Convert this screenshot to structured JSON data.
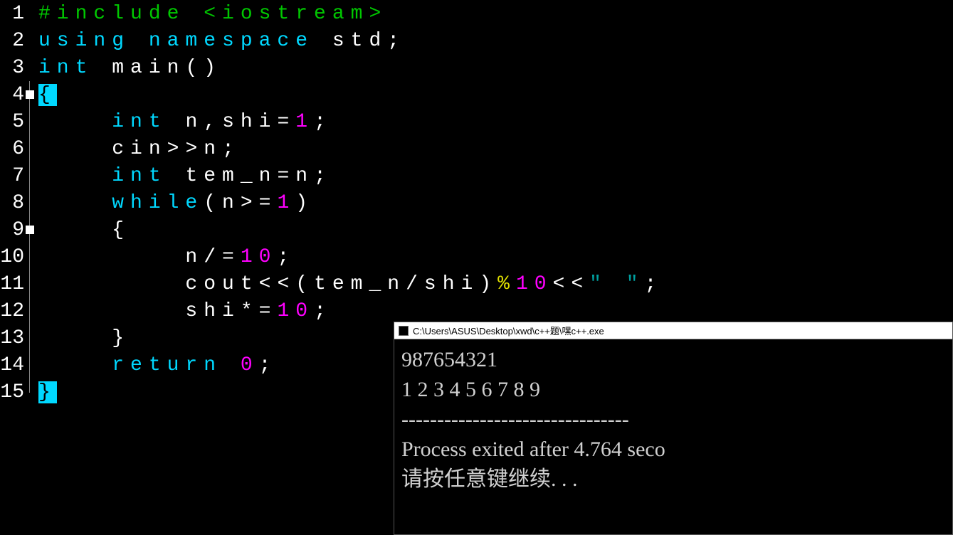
{
  "code_lines": [
    {
      "num": "1",
      "fold": null,
      "segments": [
        {
          "text": "#include <iostream>",
          "class": "c-green"
        }
      ]
    },
    {
      "num": "2",
      "fold": null,
      "segments": [
        {
          "text": "using namespace ",
          "class": "c-cyan"
        },
        {
          "text": "std",
          "class": "c-white"
        },
        {
          "text": ";",
          "class": "c-white"
        }
      ]
    },
    {
      "num": "3",
      "fold": null,
      "segments": [
        {
          "text": "int ",
          "class": "c-cyan"
        },
        {
          "text": "main",
          "class": "c-white"
        },
        {
          "text": "()",
          "class": "c-white"
        }
      ]
    },
    {
      "num": "4",
      "fold": "marker",
      "segments": [
        {
          "text": "{",
          "class": "hl-brace"
        }
      ]
    },
    {
      "num": "5",
      "fold": "line",
      "segments": [
        {
          "text": "    ",
          "class": "c-white"
        },
        {
          "text": "int ",
          "class": "c-cyan"
        },
        {
          "text": "n",
          "class": "c-white"
        },
        {
          "text": ",",
          "class": "c-white"
        },
        {
          "text": "shi",
          "class": "c-white"
        },
        {
          "text": "=",
          "class": "c-white"
        },
        {
          "text": "1",
          "class": "c-magenta"
        },
        {
          "text": ";",
          "class": "c-white"
        }
      ]
    },
    {
      "num": "6",
      "fold": "line",
      "segments": [
        {
          "text": "    ",
          "class": "c-white"
        },
        {
          "text": "cin",
          "class": "c-white"
        },
        {
          "text": ">>",
          "class": "c-white"
        },
        {
          "text": "n",
          "class": "c-white"
        },
        {
          "text": ";",
          "class": "c-white"
        }
      ]
    },
    {
      "num": "7",
      "fold": "line",
      "segments": [
        {
          "text": "    ",
          "class": "c-white"
        },
        {
          "text": "int ",
          "class": "c-cyan"
        },
        {
          "text": "tem_n",
          "class": "c-white"
        },
        {
          "text": "=",
          "class": "c-white"
        },
        {
          "text": "n",
          "class": "c-white"
        },
        {
          "text": ";",
          "class": "c-white"
        }
      ]
    },
    {
      "num": "8",
      "fold": "line",
      "segments": [
        {
          "text": "    ",
          "class": "c-white"
        },
        {
          "text": "while",
          "class": "c-cyan"
        },
        {
          "text": "(",
          "class": "c-white"
        },
        {
          "text": "n",
          "class": "c-white"
        },
        {
          "text": ">=",
          "class": "c-white"
        },
        {
          "text": "1",
          "class": "c-magenta"
        },
        {
          "text": ")",
          "class": "c-white"
        }
      ]
    },
    {
      "num": "9",
      "fold": "marker",
      "segments": [
        {
          "text": "    ",
          "class": "c-white"
        },
        {
          "text": "{",
          "class": "c-white"
        }
      ]
    },
    {
      "num": "10",
      "fold": "line",
      "segments": [
        {
          "text": "        ",
          "class": "c-white"
        },
        {
          "text": "n",
          "class": "c-white"
        },
        {
          "text": "/=",
          "class": "c-white"
        },
        {
          "text": "10",
          "class": "c-magenta"
        },
        {
          "text": ";",
          "class": "c-white"
        }
      ]
    },
    {
      "num": "11",
      "fold": "line",
      "segments": [
        {
          "text": "        ",
          "class": "c-white"
        },
        {
          "text": "cout",
          "class": "c-white"
        },
        {
          "text": "<<(",
          "class": "c-white"
        },
        {
          "text": "tem_n",
          "class": "c-white"
        },
        {
          "text": "/",
          "class": "c-white"
        },
        {
          "text": "shi",
          "class": "c-white"
        },
        {
          "text": ")",
          "class": "c-white"
        },
        {
          "text": "%",
          "class": "c-yellow"
        },
        {
          "text": "10",
          "class": "c-magenta"
        },
        {
          "text": "<<",
          "class": "c-white"
        },
        {
          "text": "\" \"",
          "class": "c-teal"
        },
        {
          "text": ";",
          "class": "c-white"
        }
      ]
    },
    {
      "num": "12",
      "fold": "line",
      "segments": [
        {
          "text": "        ",
          "class": "c-white"
        },
        {
          "text": "shi",
          "class": "c-white"
        },
        {
          "text": "*=",
          "class": "c-white"
        },
        {
          "text": "10",
          "class": "c-magenta"
        },
        {
          "text": ";",
          "class": "c-white"
        }
      ]
    },
    {
      "num": "13",
      "fold": "line",
      "segments": [
        {
          "text": "    ",
          "class": "c-white"
        },
        {
          "text": "}",
          "class": "c-white"
        }
      ]
    },
    {
      "num": "14",
      "fold": "line",
      "segments": [
        {
          "text": "    ",
          "class": "c-white"
        },
        {
          "text": "return ",
          "class": "c-cyan"
        },
        {
          "text": "0",
          "class": "c-magenta"
        },
        {
          "text": ";",
          "class": "c-white"
        }
      ]
    },
    {
      "num": "15",
      "fold": "line-end",
      "segments": [
        {
          "text": "}",
          "class": "hl-brace"
        }
      ]
    }
  ],
  "console": {
    "title": "C:\\Users\\ASUS\\Desktop\\xwd\\c++题\\嘿c++.exe",
    "lines": [
      "987654321",
      "1 2 3 4 5 6 7 8 9",
      "--------------------------------",
      "Process exited after 4.764 seco",
      "请按任意键继续. . ."
    ]
  }
}
